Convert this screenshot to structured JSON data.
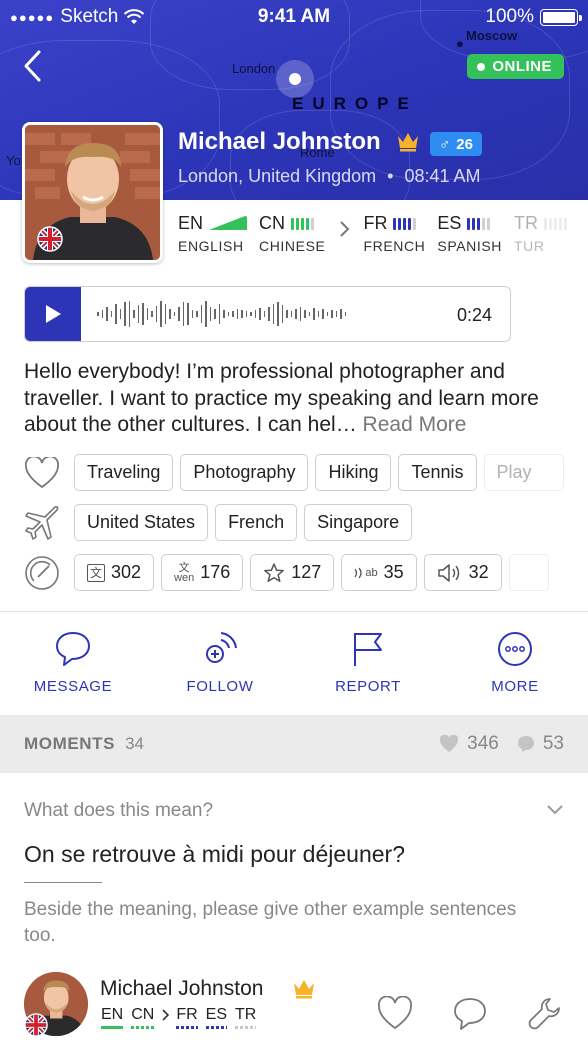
{
  "status_bar": {
    "carrier": "Sketch",
    "time": "9:41 AM",
    "battery": "100%"
  },
  "map": {
    "labels": {
      "moscow": "Moscow",
      "london": "London",
      "rome": "Rome",
      "europe": "EUROPE",
      "yo": "Yo"
    }
  },
  "header": {
    "online_label": "ONLINE"
  },
  "profile": {
    "name": "Michael Johnston",
    "gender_symbol": "♂",
    "age": "26",
    "location": "London, United Kingdom",
    "local_time": "08:41 AM",
    "languages": [
      {
        "code": "EN",
        "name": "ENGLISH",
        "color": "#34c15a",
        "level": 5,
        "native": true
      },
      {
        "code": "CN",
        "name": "CHINESE",
        "color": "#34c15a",
        "level": 4,
        "native": false
      },
      {
        "code": "FR",
        "name": "FRENCH",
        "color": "#2d35b6",
        "level": 4,
        "native": false
      },
      {
        "code": "ES",
        "name": "SPANISH",
        "color": "#2d35b6",
        "level": 3,
        "native": false
      },
      {
        "code": "TR",
        "name": "TUR",
        "color": "#c8c8c8",
        "level": 1,
        "native": false
      }
    ]
  },
  "audio": {
    "duration": "0:24"
  },
  "bio": {
    "text": "Hello everybody! I’m professional photographer and traveller. I want to practice my speaking and learn more about the other cultures. I can hel…",
    "read_more": "Read More"
  },
  "interests": [
    "Traveling",
    "Photography",
    "Hiking",
    "Tennis",
    "Play"
  ],
  "travel": [
    "United States",
    "French",
    "Singapore"
  ],
  "stats": [
    "302",
    "176",
    "127",
    "35",
    "32"
  ],
  "stat_glyphs": {
    "translate": "文",
    "wen_top": "文",
    "wen_bottom": "wen",
    "ab": "ab"
  },
  "actions": {
    "message": "MESSAGE",
    "follow": "FOLLOW",
    "report": "REPORT",
    "more": "MORE"
  },
  "moments": {
    "title": "MOMENTS",
    "count": "34",
    "likes": "346",
    "comments": "53"
  },
  "post": {
    "category": "What does this mean?",
    "question": "On se retrouve à midi pour déjeuner?",
    "description": "Beside the meaning, please give other example sentences too.",
    "author": {
      "name": "Michael Johnston",
      "languages": [
        {
          "code": "EN",
          "color": "#34c15a"
        },
        {
          "code": "CN",
          "color": "#34c15a"
        },
        {
          "code": "FR",
          "color": "#2d35b6"
        },
        {
          "code": "ES",
          "color": "#2d35b6"
        },
        {
          "code": "TR",
          "color": "#c8c8c8"
        }
      ]
    }
  },
  "colors": {
    "brand_blue": "#2d35b6",
    "online_green": "#34c15a",
    "age_blue": "#2f8df2",
    "crown_gold": "#f5b22a"
  }
}
